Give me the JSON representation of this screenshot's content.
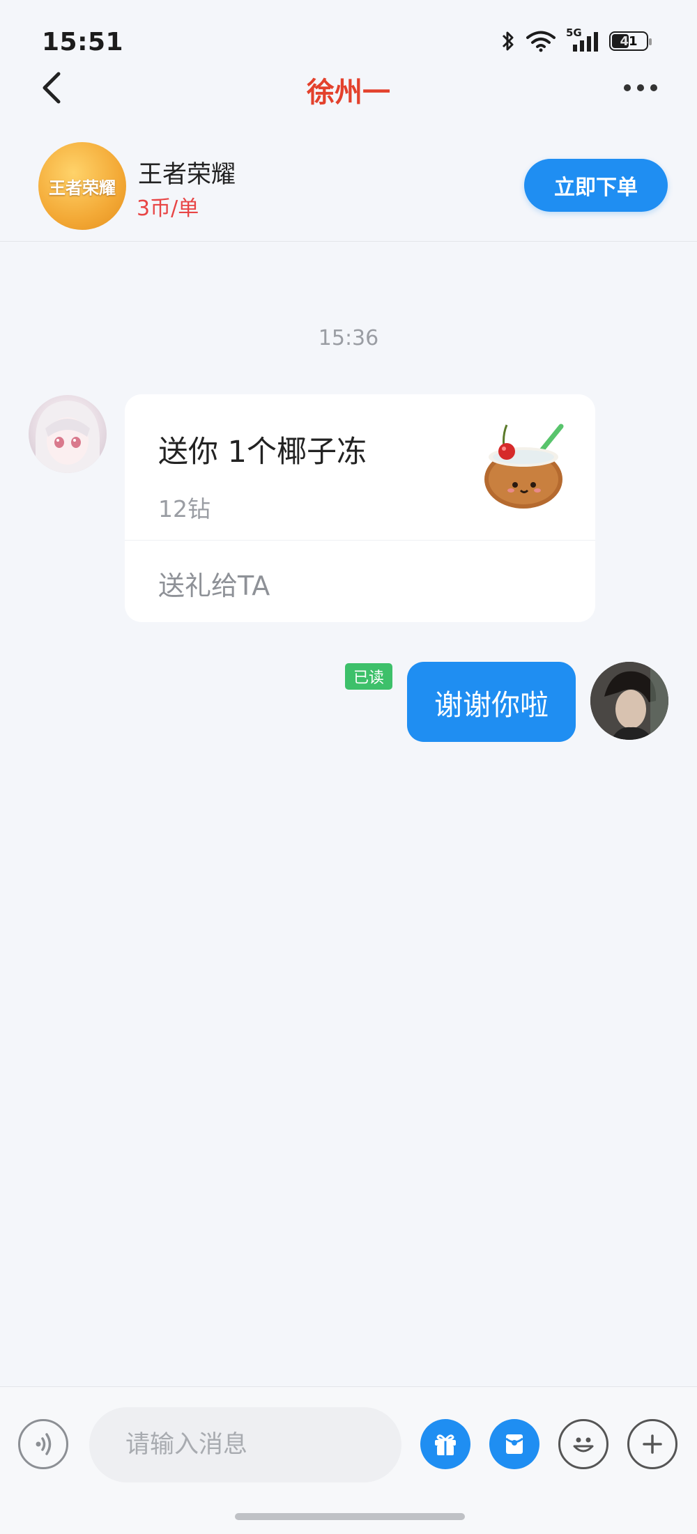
{
  "status_bar": {
    "time": "15:51",
    "network": "5G",
    "battery": "41"
  },
  "nav": {
    "title": "徐州一"
  },
  "product": {
    "logo_text": "王者荣耀",
    "name": "王者荣耀",
    "price": "3币/单",
    "order_button": "立即下单"
  },
  "chat": {
    "timestamp": "15:36",
    "gift_message": {
      "title": "送你 1个椰子冻",
      "price": "12钻",
      "action": "送礼给TA"
    },
    "my_message": {
      "text": "谢谢你啦",
      "read_status": "已读"
    }
  },
  "input_bar": {
    "placeholder": "请输入消息"
  },
  "colors": {
    "accent": "#1f8ef2",
    "title_red": "#e3412c",
    "price_red": "#e84545",
    "read_green": "#3dc06a"
  }
}
